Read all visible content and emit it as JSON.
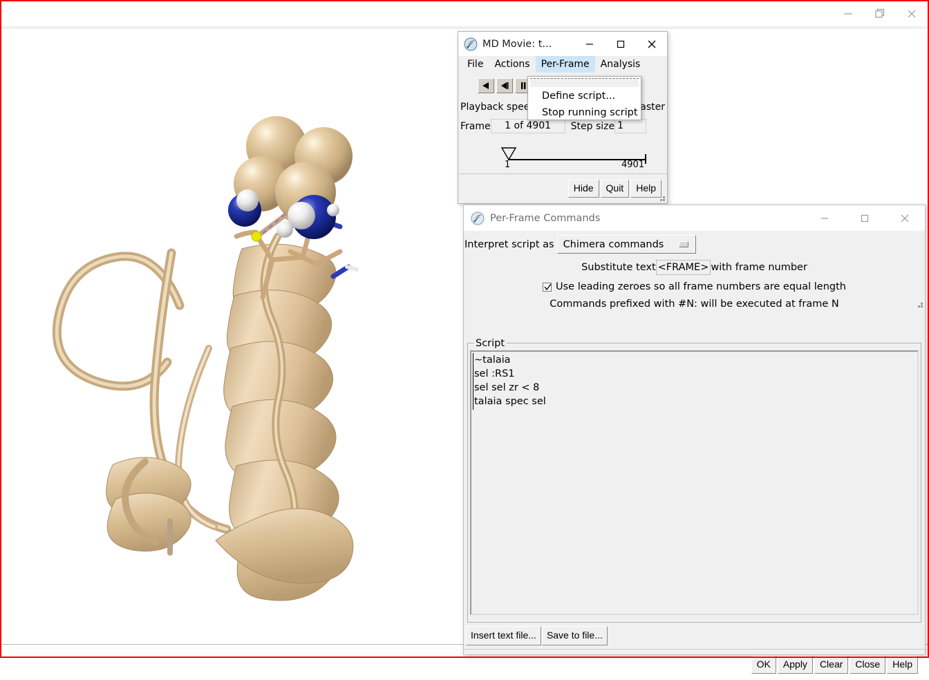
{
  "main_window": {
    "title": "",
    "controls": [
      {
        "name": "minimize",
        "glyph": "minimize-icon"
      },
      {
        "name": "restore",
        "glyph": "restore-icon"
      },
      {
        "name": "close",
        "glyph": "close-icon"
      }
    ]
  },
  "colors": {
    "recording_border": "#f40000",
    "dialog_face": "#f0f0f0",
    "titlebar": "#ffffff",
    "menu_highlight": "#cde6f7",
    "ribbon_tan": "#ddc39b",
    "atom_nitrogen": "#1f2c9e",
    "atom_hydrogen": "#f2f2f2",
    "atom_sulfur": "#e8e800",
    "hbond_purple": "#9b7fc8",
    "chimera_icon": "#2f6f8f"
  },
  "md_movie": {
    "title": "MD Movie: t...",
    "icon": "chimera-logo-icon",
    "window_controls": {
      "minimize": "minimize-icon",
      "maximize": "maximize-icon",
      "close": "close-icon"
    },
    "menus": [
      {
        "label": "File",
        "active": false
      },
      {
        "label": "Actions",
        "active": false
      },
      {
        "label": "Per-Frame",
        "active": true
      },
      {
        "label": "Analysis",
        "active": false
      }
    ],
    "transport_buttons": [
      {
        "name": "play-reverse",
        "glyph": "play-back-icon"
      },
      {
        "name": "step-reverse",
        "glyph": "step-back-icon"
      },
      {
        "name": "pause",
        "glyph": "pause-icon"
      }
    ],
    "playback_speed_label": "Playback speed",
    "playback_speed_faster": "aster",
    "frame_label": "Frame",
    "frame_value": "1 of 4901",
    "step_size_label": "Step size",
    "step_size_value": "1",
    "slider_min_label": "1",
    "slider_max_label": "4901",
    "footer_buttons": [
      "Hide",
      "Quit",
      "Help"
    ]
  },
  "per_frame_menu": {
    "items": [
      {
        "label": "Define script..."
      },
      {
        "label": "Stop running script"
      }
    ]
  },
  "per_frame_commands": {
    "title": "Per-Frame Commands",
    "icon": "chimera-logo-icon",
    "window_controls": {
      "minimize": "minimize-icon",
      "maximize": "maximize-icon",
      "close": "close-icon"
    },
    "interpret_label": "Interpret script as",
    "interpret_value": "Chimera commands",
    "substitute_prefix": "Substitute text",
    "substitute_value": "<FRAME>",
    "substitute_suffix": "with frame number",
    "leading_zeroes_checked": true,
    "leading_zeroes_label": "Use leading zeroes so all frame numbers are equal length",
    "prefix_note": "Commands prefixed with #N: will be executed at frame N",
    "script_group_label": "Script",
    "script_lines": [
      "~talaia",
      "sel :RS1",
      "sel sel zr < 8",
      "talaia spec sel"
    ],
    "file_buttons": [
      "Insert text file...",
      "Save to file..."
    ],
    "action_buttons": [
      "OK",
      "Apply",
      "Clear",
      "Close",
      "Help"
    ]
  }
}
